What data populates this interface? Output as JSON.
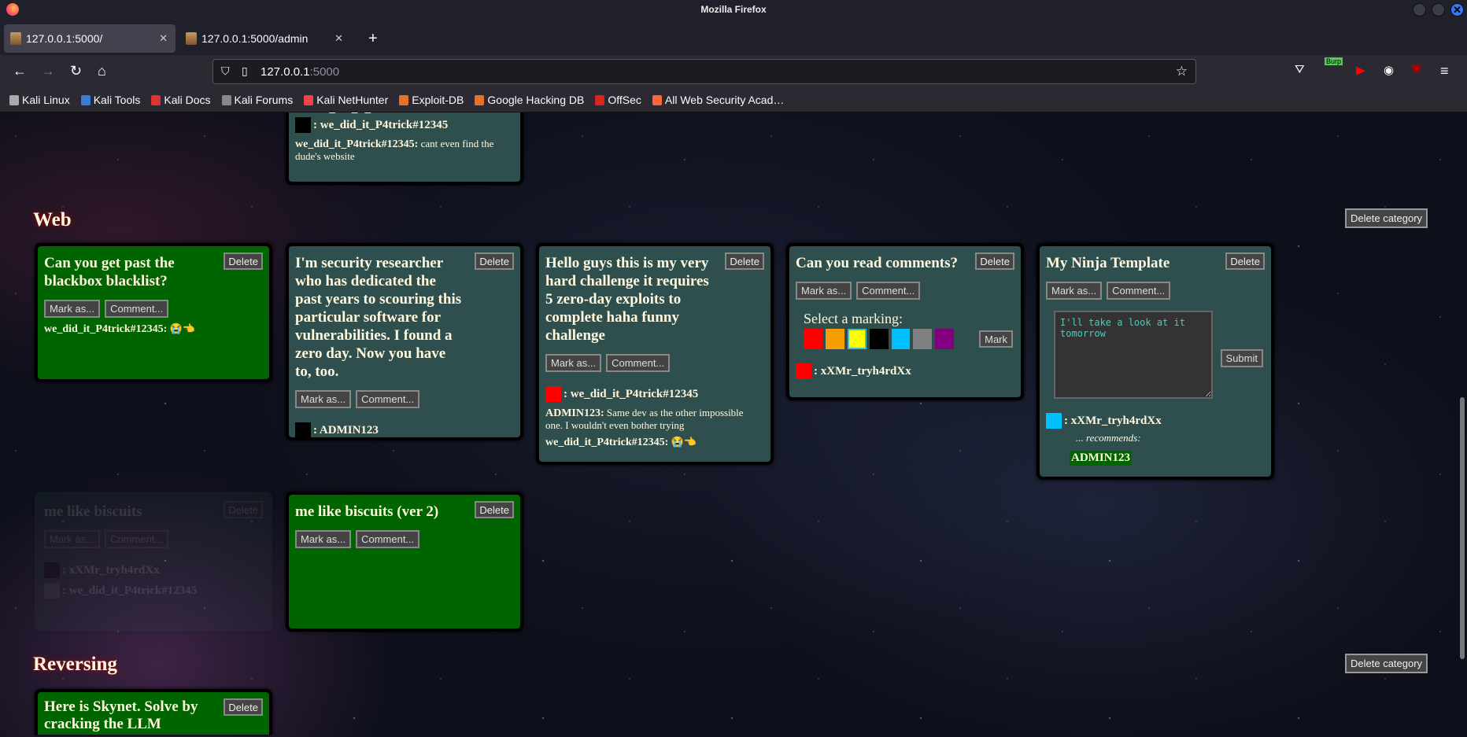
{
  "window": {
    "title": "Mozilla Firefox"
  },
  "tabs": [
    {
      "label": "127.0.0.1:5000/",
      "active": true
    },
    {
      "label": "127.0.0.1:5000/admin",
      "active": false
    }
  ],
  "url": {
    "host": "127.0.0.1",
    "port": ":5000"
  },
  "extensions": {
    "burp_label": "Burp"
  },
  "bookmarks": [
    {
      "label": "Kali Linux",
      "color": "#aaa"
    },
    {
      "label": "Kali Tools",
      "color": "#3b7bd8"
    },
    {
      "label": "Kali Docs",
      "color": "#d33"
    },
    {
      "label": "Kali Forums",
      "color": "#888"
    },
    {
      "label": "Kali NetHunter",
      "color": "#e44"
    },
    {
      "label": "Exploit-DB",
      "color": "#e8702a"
    },
    {
      "label": "Google Hacking DB",
      "color": "#e8702a"
    },
    {
      "label": "OffSec",
      "color": "#d22"
    },
    {
      "label": "All Web Security Acad…",
      "color": "#f63"
    }
  ],
  "delete_category_label": "Delete category",
  "categories": [
    {
      "name": "Web"
    },
    {
      "name": "Reversing"
    }
  ],
  "cards": [
    {
      "id": "top",
      "style": "slate",
      "title": "",
      "partial_line": "we_did_it_P4trick#12345",
      "markings": [
        {
          "color": "#000000",
          "user": ": we_did_it_P4trick#12345"
        }
      ],
      "comments": [
        {
          "user": "we_did_it_P4trick#12345:",
          "text": "cant even find the dude's website"
        }
      ]
    },
    {
      "id": "web1",
      "style": "green",
      "title": "Can you get past the blackbox blacklist?",
      "markings": [],
      "comments": [
        {
          "user": "we_did_it_P4trick#12345:",
          "text": "😭👈"
        }
      ]
    },
    {
      "id": "web2",
      "style": "slate",
      "title": "I'm security researcher who has dedicated the past years to scouring this particular software for vulnerabilities. I found a zero day. Now you have to, too.",
      "markings": [
        {
          "color": "#000000",
          "user": ": ADMIN123"
        }
      ],
      "comments": []
    },
    {
      "id": "web3",
      "style": "slate",
      "title": "Hello guys this is my very hard challenge it requires 5 zero-day exploits to complete haha funny challenge",
      "markings": [
        {
          "color": "#ff0000",
          "user": ": we_did_it_P4trick#12345"
        }
      ],
      "comments": [
        {
          "user": "ADMIN123:",
          "text": "Same dev as the other impossible one. I wouldn't even bother trying"
        },
        {
          "user": "we_did_it_P4trick#12345:",
          "text": "😭👈"
        }
      ]
    },
    {
      "id": "web4",
      "style": "slate",
      "title": "Can you read comments?",
      "panel": {
        "label": "Select a marking:",
        "colors": [
          "#ff0000",
          "#f5a000",
          "#ffff00",
          "#000000",
          "#00bfff",
          "#808080",
          "#800080"
        ],
        "selected": 2,
        "mark_label": "Mark"
      },
      "markings": [
        {
          "color": "#ff0000",
          "user": ": xXMr_tryh4rdXx"
        }
      ],
      "comments": []
    },
    {
      "id": "web5",
      "style": "slate",
      "title": "My Ninja Template",
      "comment_box": {
        "value": "I'll take a look at it tomorrow",
        "submit_label": "Submit"
      },
      "markings": [
        {
          "color": "#00bfff",
          "user": ": xXMr_tryh4rdXx"
        }
      ],
      "recommends": {
        "label": "... recommends:",
        "user": "ADMIN123"
      },
      "comments": []
    },
    {
      "id": "web6",
      "style": "faded",
      "title": "me like biscuits",
      "markings": [
        {
          "color": "#000000",
          "user": ": xXMr_tryh4rdXx"
        },
        {
          "color": "#808080",
          "user": ": we_did_it_P4trick#12345"
        }
      ],
      "comments": []
    },
    {
      "id": "web7",
      "style": "green",
      "title": "me like biscuits (ver 2)",
      "markings": [],
      "comments": []
    },
    {
      "id": "rev1",
      "style": "green",
      "title": "Here is Skynet. Solve by cracking the LLM",
      "markings": [],
      "comments": []
    }
  ],
  "labels": {
    "delete": "Delete",
    "mark_as": "Mark as...",
    "comment": "Comment..."
  }
}
